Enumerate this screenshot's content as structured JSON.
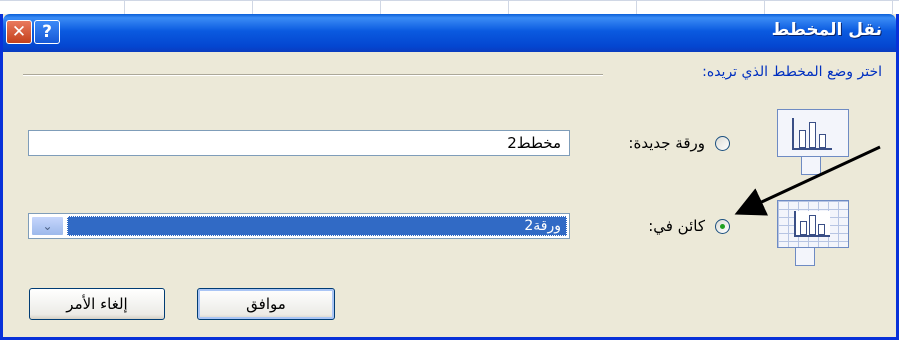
{
  "dialog": {
    "title": "نقل المخطط",
    "help_glyph": "?",
    "close_glyph": "✕",
    "group_label": "اختر وضع المخطط الذي تريده:"
  },
  "option_new_sheet": {
    "label": "ورقة جديدة:",
    "value": "مخطط2",
    "selected": false,
    "icon": "chart-sheet-icon"
  },
  "option_object_in": {
    "label": "كائن في:",
    "value": "ورقة2",
    "selected": true,
    "icon": "embedded-chart-icon"
  },
  "buttons": {
    "ok_label": "موافق",
    "cancel_label": "إلغاء الأمر"
  },
  "colors": {
    "titlebar": "#0a5ae0",
    "dialog_bg": "#ece9d8",
    "selection": "#316ac5",
    "group_label": "#0030c0"
  }
}
